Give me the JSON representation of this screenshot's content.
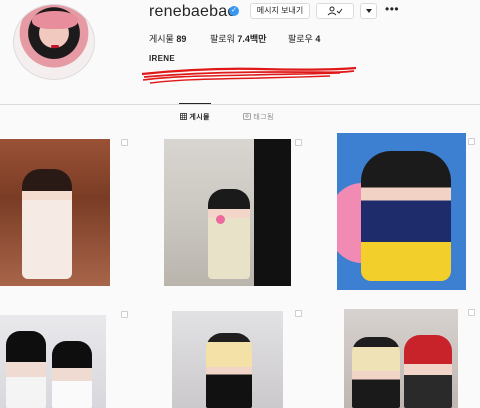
{
  "profile": {
    "username": "renebaebae",
    "verified_icon": "verified-badge-icon",
    "message_button": "메시지 보내기",
    "follow_icon": "person-check-icon",
    "dropdown_icon": "chevron-down-icon",
    "more_icon": "more-options-icon",
    "more_glyph": "•••",
    "stats": {
      "posts_label": "게시물",
      "posts_value": "89",
      "followers_label": "팔로워",
      "followers_value": "7.4백만",
      "following_label": "팔로우",
      "following_value": "4"
    },
    "display_name": "IRENE"
  },
  "tabs": [
    {
      "label": "게시물",
      "icon": "grid-icon",
      "active": true
    },
    {
      "label": "태그됨",
      "icon": "tag-icon",
      "active": false
    }
  ],
  "colors": {
    "verified": "#3897f0",
    "scribble": "#e01818",
    "border": "#dbdbdb"
  }
}
